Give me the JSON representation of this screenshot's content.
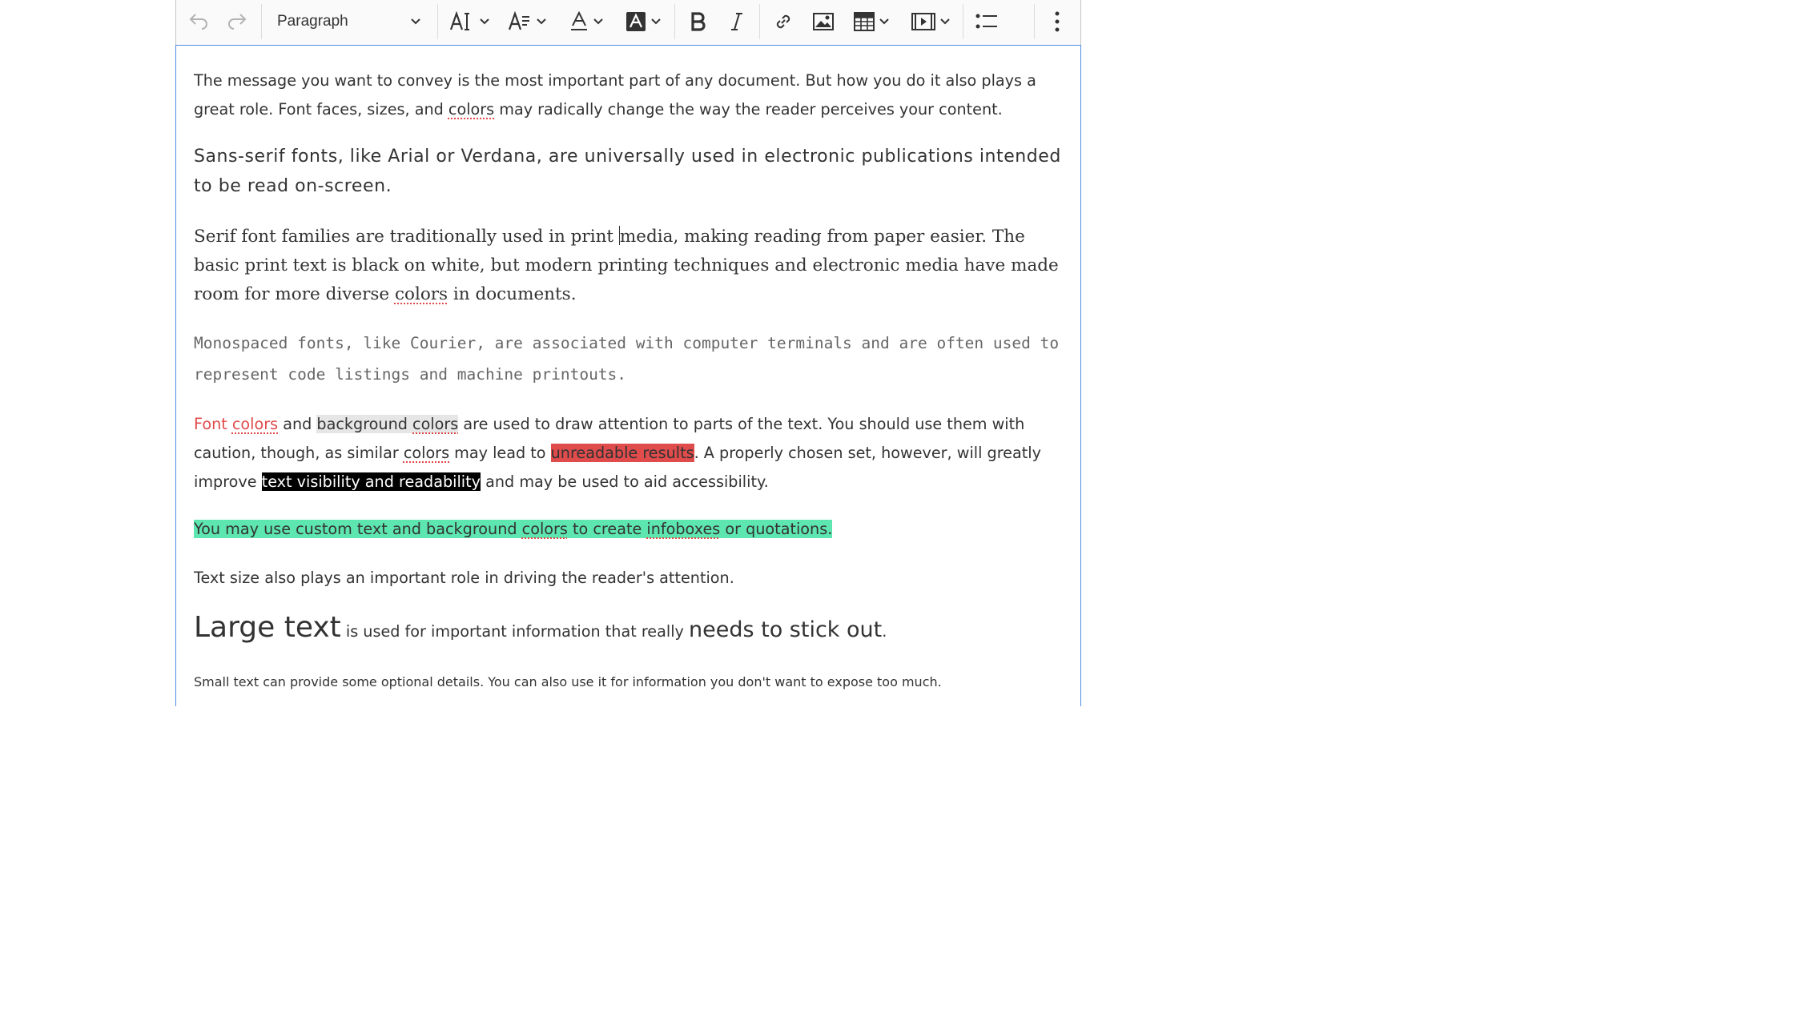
{
  "toolbar": {
    "undo_icon": "undo-icon",
    "redo_icon": "redo-icon",
    "heading_value": "Paragraph",
    "font_size_icon": "font-size-icon",
    "font_family_icon": "font-family-icon",
    "font_color_icon": "font-color-icon",
    "background_color_icon": "font-background-color-icon",
    "bold_icon": "bold-icon",
    "italic_icon": "italic-icon",
    "link_icon": "link-icon",
    "image_icon": "image-icon",
    "table_icon": "table-icon",
    "media_icon": "media-embed-icon",
    "list_icon": "bulleted-list-icon",
    "more_icon": "more-vertical-icon"
  },
  "colors": {
    "accent_border": "#4f8de7",
    "font_red": "#e04b4b",
    "bg_grey": "#e6e6e6",
    "bg_red": "#e04b4b",
    "bg_black": "#000000",
    "bg_green": "#5ee6b0"
  },
  "content": {
    "p1": {
      "a": "The message you want to convey is the most important part of any document. But how you do it also plays a great role. Font faces, sizes, and ",
      "colors": "colors",
      "b": " may radically change the way the reader perceives your content."
    },
    "p2": "Sans-serif fonts, like Arial or Verdana, are universally used in electronic publications intended to be read on-screen.",
    "p3": {
      "a": "Serif font families are traditionally used in print ",
      "b": "media, making reading from paper easier. The basic print text is black on white, but modern printing techniques and electronic media have made room for more diverse ",
      "colors": "colors",
      "c": " in documents."
    },
    "p4": "Monospaced fonts, like Courier, are associated with computer terminals and are often used to represent code listings and machine printouts.",
    "p5": {
      "font": "Font ",
      "colors1": "colors",
      "and": " and ",
      "background": "background ",
      "colors2": "colors",
      "a": " are used to draw attention to parts of the text. You should use them with caution, though, as similar ",
      "colors3": "colors",
      "b": " may lead to ",
      "unreadable": "unreadable results",
      "c": ". A properly chosen set, however, will greatly improve ",
      "visibility": "text visibility and readability",
      "d": " and may be used to aid accessibility."
    },
    "p6": {
      "a": "You may use custom text and background ",
      "colors": "colors",
      "b": " to create ",
      "infoboxes": "infoboxes",
      "c": " or quotations."
    },
    "p7": "Text size also plays an important role in driving the reader's attention.",
    "p8": {
      "large": "Large text",
      "a": " is used for important information that really ",
      "big": "needs to stick out",
      "b": "."
    },
    "p9": "Small text can provide some optional details. You can also use it for information you don't want to expose too much."
  }
}
